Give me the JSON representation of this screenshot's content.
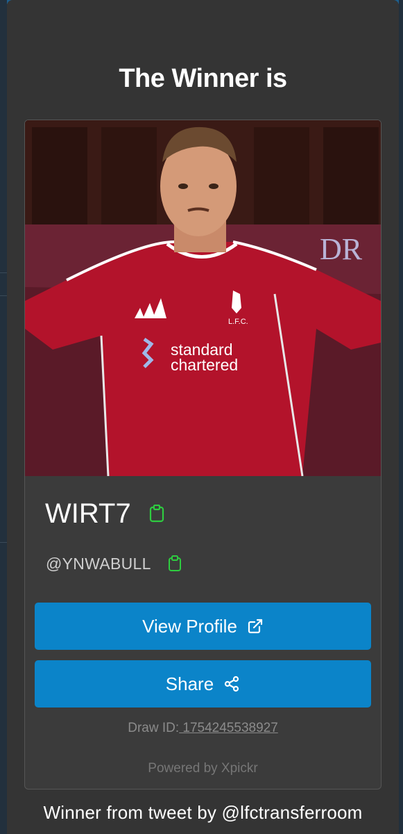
{
  "modal": {
    "title": "The Winner is",
    "winner": {
      "display_name": "WIRT7",
      "handle": "@YNWABULL",
      "photo_text": {
        "sponsor_line1": "standard",
        "sponsor_line2": "chartered",
        "club_badge": "L.F.C.",
        "banner_text": "DR"
      }
    },
    "buttons": {
      "view_profile": "View Profile",
      "share": "Share"
    },
    "draw_id": {
      "label": "Draw ID:",
      "value": " 1754245538927"
    },
    "powered_by": "Powered by Xpickr",
    "footer": "Winner from tweet by @lfctransferroom"
  },
  "icons": {
    "copy": "clipboard-icon",
    "external": "external-link-icon",
    "share": "share-nodes-icon"
  },
  "colors": {
    "primary_button": "#0b84c9",
    "copy_icon": "#2ecc40",
    "modal_bg": "#343434",
    "card_bg": "#3b3b3b"
  }
}
